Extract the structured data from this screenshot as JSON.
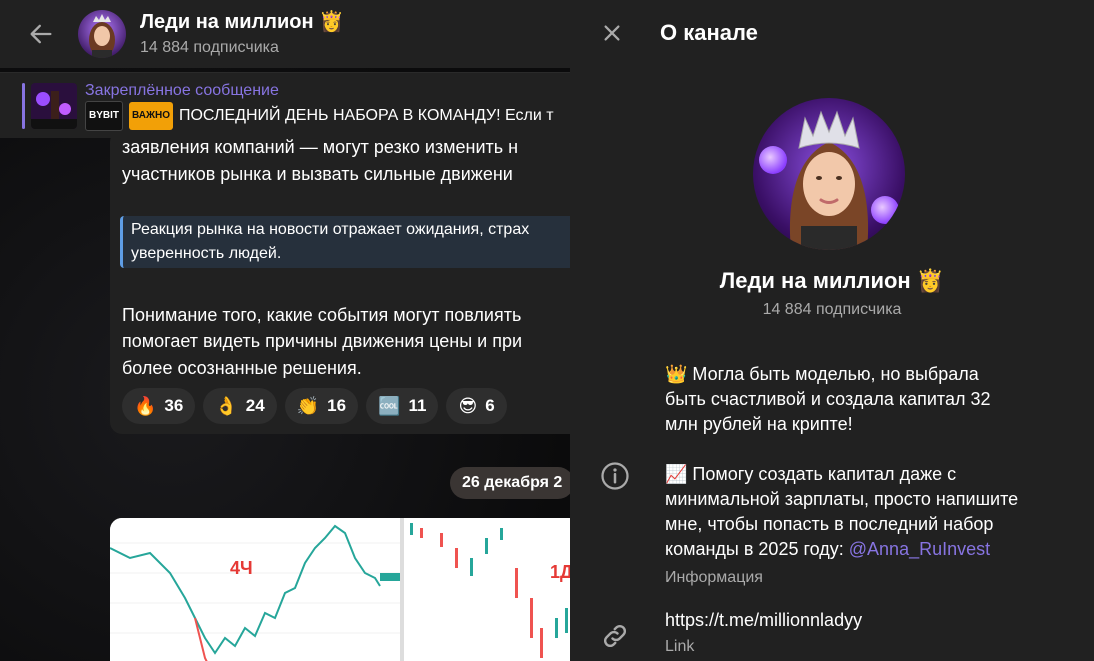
{
  "chat": {
    "title": "Леди на миллион 👸",
    "subscribers": "14 884 подписчика",
    "pinned": {
      "label": "Закреплённое сообщение",
      "badge1": "BYBIT",
      "badge2": "ВАЖНО",
      "text": "ПОСЛЕДНИЙ ДЕНЬ НАБОРА В КОМАНДУ! Если т"
    },
    "message": {
      "line1": "заявления компаний — могут резко изменить н",
      "line2": "участников рынка и вызвать сильные движени",
      "quote_line1": "Реакция рынка на новости отражает ожидания, страх",
      "quote_line2": "уверенность людей.",
      "line3": "Понимание того, какие события могут повлиять",
      "line4": "помогает видеть причины движения цены и при",
      "line5": "более осознанные решения."
    },
    "reactions": [
      {
        "emoji": "🔥",
        "count": "36"
      },
      {
        "emoji": "👌",
        "count": "24"
      },
      {
        "emoji": "👏",
        "count": "16"
      },
      {
        "emoji": "🆒",
        "count": "11"
      },
      {
        "emoji": "😎",
        "count": "6"
      }
    ],
    "date_pill": "26 декабря 2",
    "chart_labels": {
      "left": "4Ч",
      "right": "1Д"
    }
  },
  "panel": {
    "title": "О канале",
    "name": "Леди на миллион 👸",
    "subscribers": "14 884 подписчика",
    "desc1_line1": "👑 Могла быть моделью, но выбрала",
    "desc1_line2": "быть счастливой и создала капитал 32",
    "desc1_line3": "млн рублей на крипте!",
    "desc2_line1": "📈 Помогу создать капитал даже с",
    "desc2_line2": "минимальной зарплаты, просто напишите",
    "desc2_line3": "мне, чтобы попасть в последний набор",
    "desc2_line4": "команды в 2025 году: ",
    "desc2_link": "@Anna_RuInvest",
    "info_caption": "Информация",
    "link_url": "https://t.me/millionnladyy",
    "link_caption": "Link"
  },
  "colors": {
    "accent": "#8774e1",
    "panel_bg": "#212121",
    "quote_border": "#5f9ee6"
  },
  "icons": [
    "back-arrow-icon",
    "close-icon",
    "info-icon",
    "link-icon"
  ]
}
